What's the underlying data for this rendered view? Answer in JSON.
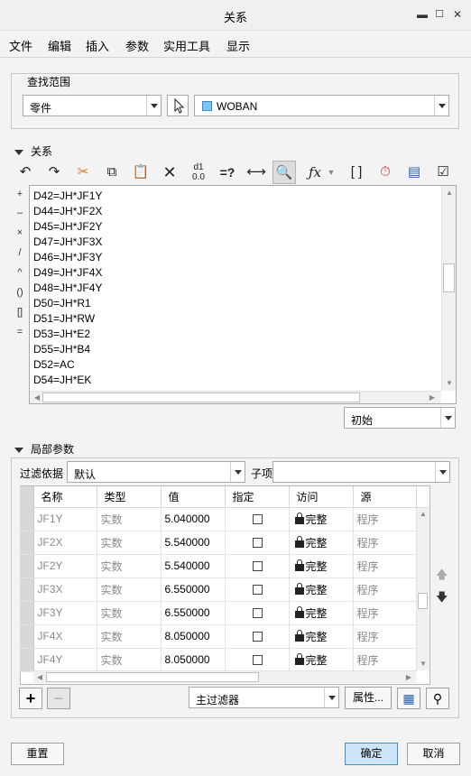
{
  "window": {
    "title": "关系"
  },
  "menu": [
    "文件",
    "编辑",
    "插入",
    "参数",
    "实用工具",
    "显示"
  ],
  "search_scope": {
    "label": "查找范围",
    "type_value": "零件",
    "model_value": "WOBAN"
  },
  "relations": {
    "title": "关系",
    "side_ops": [
      "+",
      "–",
      "×",
      "/",
      "^",
      "()",
      "[]",
      "="
    ],
    "lines": [
      "D42=JH*JF1Y",
      "D44=JH*JF2X",
      "D45=JH*JF2Y",
      "D47=JH*JF3X",
      "D46=JH*JF3Y",
      "D49=JH*JF4X",
      "D48=JH*JF4Y",
      "D50=JH*R1",
      "D51=JH*RW",
      "D53=JH*E2",
      "D55=JH*B4",
      "D52=AC",
      "D54=JH*EK"
    ],
    "state_value": "初始"
  },
  "local_params": {
    "title": "局部参数",
    "filter_label": "过滤依据",
    "filter_value": "默认",
    "child_label": "子项",
    "columns": [
      "名称",
      "类型",
      "值",
      "指定",
      "访问",
      "源"
    ],
    "rows": [
      {
        "name": "JF1Y",
        "type": "实数",
        "value": "5.040000",
        "access": "完整",
        "source": "程序"
      },
      {
        "name": "JF2X",
        "type": "实数",
        "value": "5.540000",
        "access": "完整",
        "source": "程序"
      },
      {
        "name": "JF2Y",
        "type": "实数",
        "value": "5.540000",
        "access": "完整",
        "source": "程序"
      },
      {
        "name": "JF3X",
        "type": "实数",
        "value": "6.550000",
        "access": "完整",
        "source": "程序"
      },
      {
        "name": "JF3Y",
        "type": "实数",
        "value": "6.550000",
        "access": "完整",
        "source": "程序"
      },
      {
        "name": "JF4X",
        "type": "实数",
        "value": "8.050000",
        "access": "完整",
        "source": "程序"
      },
      {
        "name": "JF4Y",
        "type": "实数",
        "value": "8.050000",
        "access": "完整",
        "source": "程序"
      }
    ],
    "main_filter_value": "主过滤器",
    "properties_label": "属性..."
  },
  "footer": {
    "reset_label": "重置",
    "ok_label": "确定",
    "cancel_label": "取消"
  }
}
